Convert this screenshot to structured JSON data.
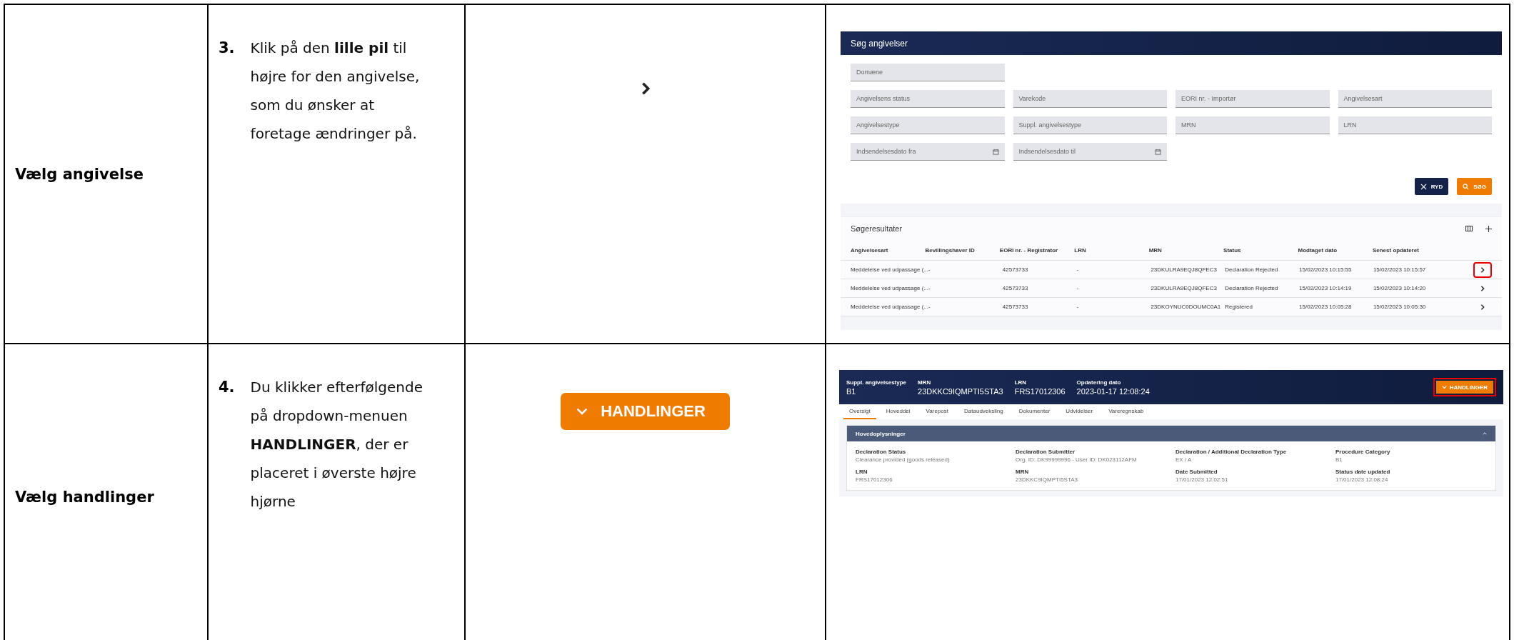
{
  "steps": [
    {
      "title": "Vælg angivelse",
      "number": "3.",
      "text": "Klik på den **lille pil** til højre for den angivelse, som du ønsker at foretage ændringer på.",
      "illustration": {
        "kind": "chevron"
      },
      "screenshot": {
        "kind": "search",
        "search_title": "Søg angivelser",
        "field_rows": [
          [
            {
              "placeholder": "Domæne",
              "kind": "text"
            }
          ],
          [
            {
              "placeholder": "Angivelsens status",
              "kind": "text"
            },
            {
              "placeholder": "Varekode",
              "kind": "text"
            },
            {
              "placeholder": "EORI nr. - Importør",
              "kind": "text"
            },
            {
              "placeholder": "Angivelsesart",
              "kind": "text"
            }
          ],
          [
            {
              "placeholder": "Angivelsestype",
              "kind": "text"
            },
            {
              "placeholder": "Suppl. angivelsestype",
              "kind": "text"
            },
            {
              "placeholder": "MRN",
              "kind": "text"
            },
            {
              "placeholder": "LRN",
              "kind": "text"
            }
          ],
          [
            {
              "placeholder": "Indsendelsesdato fra",
              "kind": "date"
            },
            {
              "placeholder": "Indsendelsesdato til",
              "kind": "date"
            }
          ]
        ],
        "buttons": [
          {
            "label": "RYD",
            "kind": "clear"
          },
          {
            "label": "SØG",
            "kind": "search"
          }
        ],
        "results_title": "Søgeresultater",
        "columns": [
          "Angivelsesart",
          "Bevillingshaver ID",
          "EORI nr. - Registrator",
          "LRN",
          "MRN",
          "Status",
          "Modtaget dato",
          "Senest opdateret"
        ],
        "rows": [
          {
            "cells": [
              "Meddelelse ved udpassage (...",
              "-",
              "42573733",
              "-",
              "23DKULRA9EQJ8QFEC3",
              "Declaration Rejected",
              "15/02/2023 10:15:55",
              "15/02/2023 10:15:57"
            ],
            "highlighted": true
          },
          {
            "cells": [
              "Meddelelse ved udpassage (...",
              "-",
              "42573733",
              "-",
              "23DKULRA9EQJ8QFEC3",
              "Declaration Rejected",
              "15/02/2023 10:14:19",
              "15/02/2023 10:14:20"
            ],
            "highlighted": false
          },
          {
            "cells": [
              "Meddelelse ved udpassage (...",
              "-",
              "42573733",
              "-",
              "23DKOYNUC0DOUMC0A1",
              "Registered",
              "15/02/2023 10:05:28",
              "15/02/2023 10:05:30"
            ],
            "highlighted": false
          }
        ]
      }
    },
    {
      "title": "Vælg handlinger",
      "number": "4.",
      "text": "Du klikker efterfølgende på dropdown-menuen **HANDLINGER**, der er placeret i øverste højre hjørne",
      "illustration": {
        "kind": "button",
        "label": "HANDLINGER"
      },
      "screenshot": {
        "kind": "detail",
        "header_fields": [
          {
            "label": "Suppl. angivelsestype",
            "value": "B1"
          },
          {
            "label": "MRN",
            "value": "23DKKC9IQMPTI5STA3"
          },
          {
            "label": "LRN",
            "value": "FRS17012306"
          },
          {
            "label": "Opdatering dato",
            "value": "2023-01-17 12:08:24"
          }
        ],
        "action_button": {
          "label": "HANDLINGER",
          "highlighted": true
        },
        "tabs": [
          {
            "label": "Oversigt",
            "selected": true
          },
          {
            "label": "Hoveddel",
            "selected": false
          },
          {
            "label": "Varepost",
            "selected": false
          },
          {
            "label": "Dataudveksling",
            "selected": false
          },
          {
            "label": "Dokumenter",
            "selected": false
          },
          {
            "label": "Udvidelser",
            "selected": false
          },
          {
            "label": "Vareregnskab",
            "selected": false
          }
        ],
        "section": {
          "title": "Hovedoplysninger",
          "expanded": true,
          "fields": [
            {
              "label": "Declaration Status",
              "value": "Clearance provided (goods released)"
            },
            {
              "label": "Declaration Submitter",
              "value": "Org. ID: DK99999996 - User ID: DK023112AFM"
            },
            {
              "label": "Declaration / Additional Declaration Type",
              "value": "EX / A"
            },
            {
              "label": "Procedure Category",
              "value": "B1"
            },
            {
              "label": "LRN",
              "value": "FRS17012306"
            },
            {
              "label": "MRN",
              "value": "23DKKC9IQMPTI5STA3"
            },
            {
              "label": "Date Submitted",
              "value": "17/01/2023 12:02:51"
            },
            {
              "label": "Status date updated",
              "value": "17/01/2023 12:08:24"
            }
          ]
        }
      }
    }
  ]
}
